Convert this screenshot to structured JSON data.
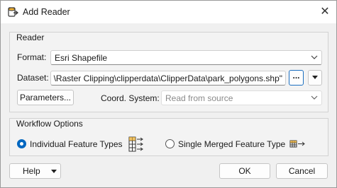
{
  "window": {
    "title": "Add Reader",
    "close_symbol": "✕"
  },
  "reader_group": {
    "title": "Reader",
    "format_label": "Format:",
    "format_value": "Esri Shapefile",
    "dataset_label": "Dataset:",
    "dataset_value": "\\Raster Clipping\\clipperdata\\ClipperData\\park_polygons.shp\"",
    "browse_label": "...",
    "parameters_label": "Parameters...",
    "coord_label": "Coord. System:",
    "coord_value": "Read from source"
  },
  "workflow_group": {
    "title": "Workflow Options",
    "option_individual": "Individual Feature Types",
    "option_single": "Single Merged Feature Type",
    "selected": "individual"
  },
  "footer": {
    "help_label": "Help",
    "ok_label": "OK",
    "cancel_label": "Cancel"
  },
  "colors": {
    "accent": "#0067c0",
    "dialog_bg": "#f0f0f0"
  },
  "icons": [
    "reader-app-icon",
    "close-icon",
    "chevron-down-icon",
    "feature-types-icon",
    "merged-feature-type-icon"
  ]
}
